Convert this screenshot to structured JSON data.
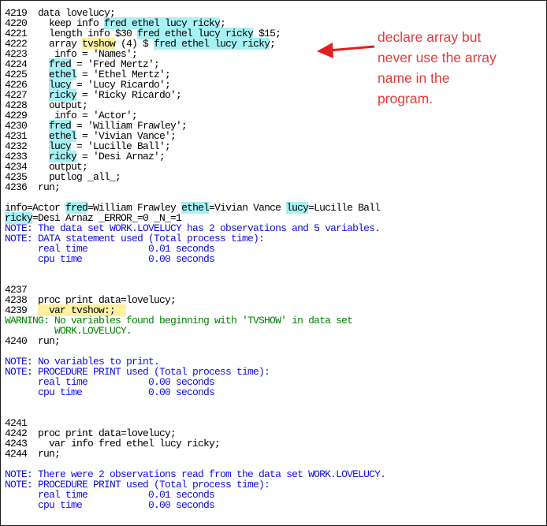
{
  "annotation": {
    "lines": [
      "declare array but",
      "never use the array",
      "name in the",
      "program."
    ],
    "color": "#e53a3a"
  },
  "colors": {
    "note": "#1010e0",
    "warning": "#008000",
    "highlight_var": "#a6f1f4",
    "highlight_tvshow": "#fff0a0",
    "arrow": "#e02020"
  },
  "log": [
    {
      "t": "default",
      "segs": [
        {
          "text": "4219  data lovelucy;"
        }
      ]
    },
    {
      "t": "default",
      "segs": [
        {
          "text": "4220    keep info "
        },
        {
          "text": "fred ethel lucy ricky",
          "h": "c"
        },
        {
          "text": ";"
        }
      ]
    },
    {
      "t": "default",
      "segs": [
        {
          "text": "4221    length info $30 "
        },
        {
          "text": "fred ethel lucy ricky",
          "h": "c"
        },
        {
          "text": " $15;"
        }
      ]
    },
    {
      "t": "default",
      "segs": [
        {
          "text": "4222    array "
        },
        {
          "text": "tvshow",
          "h": "y"
        },
        {
          "text": " (4) $ "
        },
        {
          "text": "fred ethel lucy ricky",
          "h": "c"
        },
        {
          "text": ";"
        }
      ]
    },
    {
      "t": "default",
      "segs": [
        {
          "text": "4223     info = 'Names';"
        }
      ]
    },
    {
      "t": "default",
      "segs": [
        {
          "text": "4224    "
        },
        {
          "text": "fred",
          "h": "c"
        },
        {
          "text": " = 'Fred Mertz';"
        }
      ]
    },
    {
      "t": "default",
      "segs": [
        {
          "text": "4225    "
        },
        {
          "text": "ethel",
          "h": "c"
        },
        {
          "text": " = 'Ethel Mertz';"
        }
      ]
    },
    {
      "t": "default",
      "segs": [
        {
          "text": "4226    "
        },
        {
          "text": "lucy",
          "h": "c"
        },
        {
          "text": " = 'Lucy Ricardo';"
        }
      ]
    },
    {
      "t": "default",
      "segs": [
        {
          "text": "4227    "
        },
        {
          "text": "ricky",
          "h": "c"
        },
        {
          "text": " = 'Ricky Ricardo';"
        }
      ]
    },
    {
      "t": "default",
      "segs": [
        {
          "text": "4228    output;"
        }
      ]
    },
    {
      "t": "default",
      "segs": [
        {
          "text": "4229     info = 'Actor';"
        }
      ]
    },
    {
      "t": "default",
      "segs": [
        {
          "text": "4230    "
        },
        {
          "text": "fred",
          "h": "c"
        },
        {
          "text": " = 'William Frawley';"
        }
      ]
    },
    {
      "t": "default",
      "segs": [
        {
          "text": "4231    "
        },
        {
          "text": "ethel",
          "h": "c"
        },
        {
          "text": " = 'Vivian Vance';"
        }
      ]
    },
    {
      "t": "default",
      "segs": [
        {
          "text": "4232    "
        },
        {
          "text": "lucy",
          "h": "c"
        },
        {
          "text": " = 'Lucille Ball';"
        }
      ]
    },
    {
      "t": "default",
      "segs": [
        {
          "text": "4233    "
        },
        {
          "text": "ricky",
          "h": "c"
        },
        {
          "text": " = 'Desi Arnaz';"
        }
      ]
    },
    {
      "t": "default",
      "segs": [
        {
          "text": "4234    output;"
        }
      ]
    },
    {
      "t": "default",
      "segs": [
        {
          "text": "4235    putlog _all_;"
        }
      ]
    },
    {
      "t": "default",
      "segs": [
        {
          "text": "4236  run;"
        }
      ]
    },
    {
      "t": "default",
      "segs": [
        {
          "text": ""
        }
      ]
    },
    {
      "t": "default",
      "segs": [
        {
          "text": "info=Actor "
        },
        {
          "text": "fred",
          "h": "c"
        },
        {
          "text": "=William Frawley "
        },
        {
          "text": "ethel",
          "h": "c"
        },
        {
          "text": "=Vivian Vance "
        },
        {
          "text": "lucy",
          "h": "c"
        },
        {
          "text": "=Lucille Ball"
        }
      ]
    },
    {
      "t": "default",
      "segs": [
        {
          "text": "ricky",
          "h": "c"
        },
        {
          "text": "=Desi Arnaz _ERROR_=0 _N_=1"
        }
      ]
    },
    {
      "t": "note",
      "segs": [
        {
          "text": "NOTE: The data set WORK.LOVELUCY has 2 observations and 5 variables."
        }
      ]
    },
    {
      "t": "note",
      "segs": [
        {
          "text": "NOTE: DATA statement used (Total process time):"
        }
      ]
    },
    {
      "t": "note",
      "segs": [
        {
          "text": "      real time           0.01 seconds"
        }
      ]
    },
    {
      "t": "note",
      "segs": [
        {
          "text": "      cpu time            0.00 seconds"
        }
      ]
    },
    {
      "t": "default",
      "segs": [
        {
          "text": ""
        }
      ]
    },
    {
      "t": "default",
      "segs": [
        {
          "text": ""
        }
      ]
    },
    {
      "t": "default",
      "segs": [
        {
          "text": "4237"
        }
      ]
    },
    {
      "t": "default",
      "segs": [
        {
          "text": "4238  proc print data=lovelucy;"
        }
      ]
    },
    {
      "t": "default",
      "segs": [
        {
          "text": "4239  "
        },
        {
          "text": "  var tvshow:;  ",
          "h": "y"
        }
      ]
    },
    {
      "t": "warn",
      "segs": [
        {
          "text": "WARNING: No variables found beginning with 'TVSHOW' in data set"
        }
      ]
    },
    {
      "t": "warn",
      "segs": [
        {
          "text": "         WORK.LOVELUCY."
        }
      ]
    },
    {
      "t": "default",
      "segs": [
        {
          "text": "4240  run;"
        }
      ]
    },
    {
      "t": "default",
      "segs": [
        {
          "text": ""
        }
      ]
    },
    {
      "t": "note",
      "segs": [
        {
          "text": "NOTE: No variables to print."
        }
      ]
    },
    {
      "t": "note",
      "segs": [
        {
          "text": "NOTE: PROCEDURE PRINT used (Total process time):"
        }
      ]
    },
    {
      "t": "note",
      "segs": [
        {
          "text": "      real time           0.00 seconds"
        }
      ]
    },
    {
      "t": "note",
      "segs": [
        {
          "text": "      cpu time            0.00 seconds"
        }
      ]
    },
    {
      "t": "default",
      "segs": [
        {
          "text": ""
        }
      ]
    },
    {
      "t": "default",
      "segs": [
        {
          "text": ""
        }
      ]
    },
    {
      "t": "default",
      "segs": [
        {
          "text": "4241"
        }
      ]
    },
    {
      "t": "default",
      "segs": [
        {
          "text": "4242  proc print data=lovelucy;"
        }
      ]
    },
    {
      "t": "default",
      "segs": [
        {
          "text": "4243    var info fred ethel lucy ricky;"
        }
      ]
    },
    {
      "t": "default",
      "segs": [
        {
          "text": "4244  run;"
        }
      ]
    },
    {
      "t": "default",
      "segs": [
        {
          "text": ""
        }
      ]
    },
    {
      "t": "note",
      "segs": [
        {
          "text": "NOTE: There were 2 observations read from the data set WORK.LOVELUCY."
        }
      ]
    },
    {
      "t": "note",
      "segs": [
        {
          "text": "NOTE: PROCEDURE PRINT used (Total process time):"
        }
      ]
    },
    {
      "t": "note",
      "segs": [
        {
          "text": "      real time           0.01 seconds"
        }
      ]
    },
    {
      "t": "note",
      "segs": [
        {
          "text": "      cpu time            0.00 seconds"
        }
      ]
    }
  ]
}
